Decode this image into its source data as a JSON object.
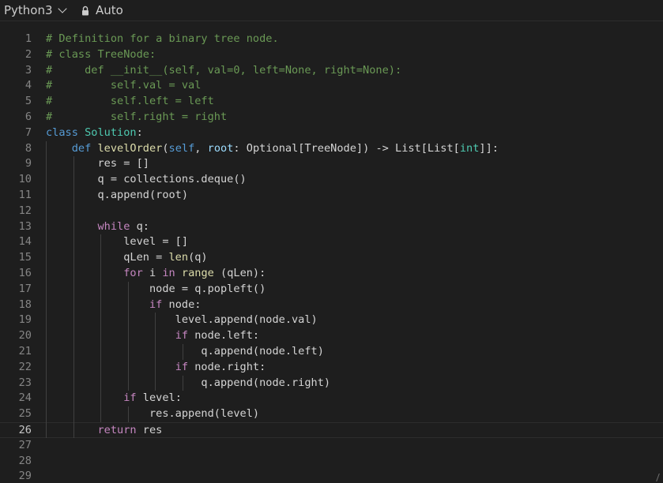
{
  "toolbar": {
    "language": "Python3",
    "language_icon": "chevron-down-icon",
    "mode": "Auto",
    "mode_icon": "lock-icon"
  },
  "editor": {
    "current_line": 26,
    "lines": [
      {
        "n": "1",
        "tokens": [
          {
            "t": "# Definition for a binary tree node.",
            "c": "t-c"
          }
        ]
      },
      {
        "n": "2",
        "tokens": [
          {
            "t": "# class TreeNode:",
            "c": "t-c"
          }
        ]
      },
      {
        "n": "3",
        "tokens": [
          {
            "t": "#     def __init__(self, val=0, left=None, right=None):",
            "c": "t-c"
          }
        ]
      },
      {
        "n": "4",
        "tokens": [
          {
            "t": "#         self.val = val",
            "c": "t-c"
          }
        ]
      },
      {
        "n": "5",
        "tokens": [
          {
            "t": "#         self.left = left",
            "c": "t-c"
          }
        ]
      },
      {
        "n": "6",
        "tokens": [
          {
            "t": "#         self.right = right",
            "c": "t-c"
          }
        ]
      },
      {
        "n": "7",
        "tokens": [
          {
            "t": "class",
            "c": "t-k"
          },
          {
            "t": " ",
            "c": "t-d"
          },
          {
            "t": "Solution",
            "c": "t-cl"
          },
          {
            "t": ":",
            "c": "t-d"
          }
        ]
      },
      {
        "n": "8",
        "tokens": [
          {
            "t": "    ",
            "c": "t-d"
          },
          {
            "t": "def",
            "c": "t-k"
          },
          {
            "t": " ",
            "c": "t-d"
          },
          {
            "t": "levelOrder",
            "c": "t-f"
          },
          {
            "t": "(",
            "c": "t-d"
          },
          {
            "t": "self",
            "c": "t-k"
          },
          {
            "t": ", ",
            "c": "t-d"
          },
          {
            "t": "root",
            "c": "t-p"
          },
          {
            "t": ": Optional[TreeNode]) -> List[List[",
            "c": "t-d"
          },
          {
            "t": "int",
            "c": "t-cl"
          },
          {
            "t": "]]:",
            "c": "t-d"
          }
        ]
      },
      {
        "n": "9",
        "tokens": [
          {
            "t": "        res = []",
            "c": "t-d"
          }
        ]
      },
      {
        "n": "10",
        "tokens": [
          {
            "t": "        q = collections.deque()",
            "c": "t-d"
          }
        ]
      },
      {
        "n": "11",
        "tokens": [
          {
            "t": "        q.append(root)",
            "c": "t-d"
          }
        ]
      },
      {
        "n": "12",
        "tokens": []
      },
      {
        "n": "13",
        "tokens": [
          {
            "t": "        ",
            "c": "t-d"
          },
          {
            "t": "while",
            "c": "t-ctl"
          },
          {
            "t": " q:",
            "c": "t-d"
          }
        ]
      },
      {
        "n": "14",
        "tokens": [
          {
            "t": "            level = []",
            "c": "t-d"
          }
        ]
      },
      {
        "n": "15",
        "tokens": [
          {
            "t": "            qLen = ",
            "c": "t-d"
          },
          {
            "t": "len",
            "c": "t-f"
          },
          {
            "t": "(q)",
            "c": "t-d"
          }
        ]
      },
      {
        "n": "16",
        "tokens": [
          {
            "t": "            ",
            "c": "t-d"
          },
          {
            "t": "for",
            "c": "t-ctl"
          },
          {
            "t": " i ",
            "c": "t-d"
          },
          {
            "t": "in",
            "c": "t-ctl"
          },
          {
            "t": " ",
            "c": "t-d"
          },
          {
            "t": "range",
            "c": "t-f"
          },
          {
            "t": " (qLen):",
            "c": "t-d"
          }
        ]
      },
      {
        "n": "17",
        "tokens": [
          {
            "t": "                node = q.popleft()",
            "c": "t-d"
          }
        ]
      },
      {
        "n": "18",
        "tokens": [
          {
            "t": "                ",
            "c": "t-d"
          },
          {
            "t": "if",
            "c": "t-ctl"
          },
          {
            "t": " node:",
            "c": "t-d"
          }
        ]
      },
      {
        "n": "19",
        "tokens": [
          {
            "t": "                    level.append(node.val)",
            "c": "t-d"
          }
        ]
      },
      {
        "n": "20",
        "tokens": [
          {
            "t": "                    ",
            "c": "t-d"
          },
          {
            "t": "if",
            "c": "t-ctl"
          },
          {
            "t": " node.left:",
            "c": "t-d"
          }
        ]
      },
      {
        "n": "21",
        "tokens": [
          {
            "t": "                        q.append(node.left)",
            "c": "t-d"
          }
        ]
      },
      {
        "n": "22",
        "tokens": [
          {
            "t": "                    ",
            "c": "t-d"
          },
          {
            "t": "if",
            "c": "t-ctl"
          },
          {
            "t": " node.right:",
            "c": "t-d"
          }
        ]
      },
      {
        "n": "23",
        "tokens": [
          {
            "t": "                        q.append(node.right)",
            "c": "t-d"
          }
        ]
      },
      {
        "n": "24",
        "tokens": [
          {
            "t": "            ",
            "c": "t-d"
          },
          {
            "t": "if",
            "c": "t-ctl"
          },
          {
            "t": " level:",
            "c": "t-d"
          }
        ]
      },
      {
        "n": "25",
        "tokens": [
          {
            "t": "                res.append(level)",
            "c": "t-d"
          }
        ]
      },
      {
        "n": "26",
        "tokens": [
          {
            "t": "        ",
            "c": "t-d"
          },
          {
            "t": "return",
            "c": "t-ctl"
          },
          {
            "t": " res",
            "c": "t-d"
          }
        ]
      },
      {
        "n": "27",
        "tokens": []
      },
      {
        "n": "28",
        "tokens": []
      },
      {
        "n": "29",
        "tokens": []
      }
    ]
  }
}
